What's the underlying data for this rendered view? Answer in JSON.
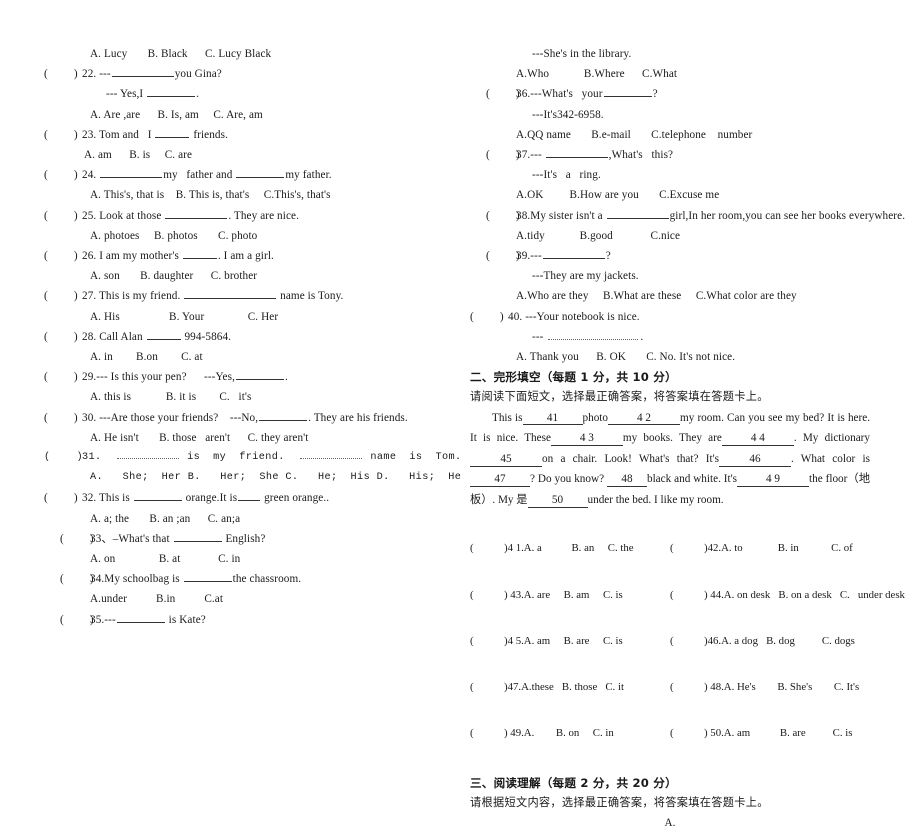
{
  "left_column": {
    "lines": [
      {
        "type": "opts",
        "text": "A. Lucy       B. Black      C. Lucy Black"
      },
      {
        "type": "q",
        "kind": "q22_stem"
      },
      {
        "type": "cont",
        "kind": "q22_answer"
      },
      {
        "type": "opts",
        "text": "A. Are ,are      B. Is, am     C. Are, am"
      },
      {
        "type": "q",
        "kind": "q23_stem"
      },
      {
        "type": "opts",
        "text": "A. am      B. is     C. are"
      },
      {
        "type": "q",
        "kind": "q24_stem"
      },
      {
        "type": "opts",
        "text": "A. This's, that is    B. This is, that's     C.This's, that's"
      },
      {
        "type": "q",
        "kind": "q25_stem"
      },
      {
        "type": "opts",
        "text": "A. photoes     B. photos       C. photo"
      },
      {
        "type": "q",
        "kind": "q26_stem"
      },
      {
        "type": "opts",
        "text": "A. son       B. daughter      C. brother"
      },
      {
        "type": "q",
        "kind": "q27_stem"
      },
      {
        "type": "opts",
        "text": "A. His                 B. Your               C. Her"
      },
      {
        "type": "q",
        "kind": "q28_stem"
      },
      {
        "type": "opts",
        "text": "A. in        B.on        C. at"
      },
      {
        "type": "q",
        "kind": "q29_stem"
      },
      {
        "type": "opts",
        "text": "A. this is            B. it is        C.   it's"
      },
      {
        "type": "q",
        "kind": "q30_stem"
      },
      {
        "type": "opts",
        "text": "A. He isn't       B. those   aren't      C. they aren't"
      },
      {
        "type": "q",
        "kind": "q31_stem"
      },
      {
        "type": "opts",
        "kind": "q31_opts"
      },
      {
        "type": "q",
        "kind": "q32_stem"
      },
      {
        "type": "opts",
        "text": "A. a; the       B. an ;an      C. an;a"
      },
      {
        "type": "q",
        "kind": "q33_stem"
      },
      {
        "type": "opts",
        "text": "A. on               B. at             C. in"
      },
      {
        "type": "q",
        "kind": "q34_stem"
      },
      {
        "type": "opts",
        "text": "A.under          B.in          C.at"
      },
      {
        "type": "q",
        "kind": "q35_stem"
      }
    ],
    "questions": {
      "q22": {
        "number": "22.",
        "pre": "---",
        "post": "you Gina?",
        "answer_pre": "--- Yes,I ",
        "answer_post": "."
      },
      "q23": {
        "number": "23.",
        "pre": "Tom and   I ",
        "post": " friends."
      },
      "q24": {
        "number": "24.",
        "pre": "",
        "mid": "my   father and ",
        "post": "my father."
      },
      "q25": {
        "number": "25.",
        "pre": "Look at those ",
        "post": ". They are nice."
      },
      "q26": {
        "number": "26.",
        "pre": "I am my mother's ",
        "post": ". I am a girl."
      },
      "q27": {
        "number": "27.",
        "pre": "This is my friend. ",
        "post": " name is Tony."
      },
      "q28": {
        "number": "28.",
        "pre": "Call Alan ",
        "post": " 994-5864."
      },
      "q29": {
        "number": "29.",
        "pre": "--- Is this your pen?      ---Yes,",
        "post": "."
      },
      "q30": {
        "number": "30.",
        "pre": "---Are those your friends?    ---No,",
        "post": ". They are his friends."
      },
      "q31": {
        "number": "31.",
        "mid": " is  my  friend. ",
        "post": " name  is  Tom.",
        "options": "A.   She;  Her B.   Her;  She C.   He;  His D.   His;  He"
      },
      "q32": {
        "number": "32.",
        "pre": "This is ",
        "mid": " orange.It is",
        "post": " green orange.."
      },
      "q33": {
        "number": "33、",
        "pre": "–What's that ",
        "post": " English?"
      },
      "q34": {
        "number": "34.",
        "pre": "My schoolbag is ",
        "post": "the chassroom."
      },
      "q35": {
        "number": "35.",
        "pre": "---",
        "post": " is Kate?"
      }
    }
  },
  "right_column": {
    "pre_lines": [
      {
        "type": "cont",
        "text": "---She's in the library."
      },
      {
        "type": "opts",
        "text": "A.Who            B.Where      C.What"
      }
    ],
    "questions": {
      "q36": {
        "number": "36.",
        "pre": "---What's   your",
        "post": "?",
        "answer": "---It's342-6958.",
        "options": "A.QQ name       B.e-mail       C.telephone    number"
      },
      "q37": {
        "number": "37.",
        "pre": "--- ",
        "post": ",What's   this?",
        "answer": "---It's   a   ring.",
        "options": "A.OK         B.How are you       C.Excuse me"
      },
      "q38": {
        "number": "38.",
        "pre": "My sister isn't a ",
        "post": "girl,In her room,you can see her books everywhere.",
        "options": "A.tidy            B.good             C.nice"
      },
      "q39": {
        "number": "39.",
        "pre": "---",
        "post": "?",
        "answer": "---They are my jackets.",
        "options": "A.Who are they     B.What are these     C.What color are they"
      },
      "q40": {
        "number": "40.",
        "pre": "---Your notebook is nice.",
        "answer_pre": "--- ",
        "answer_post": ".",
        "options": "A. Thank you      B. OK       C. No. It's not nice."
      }
    },
    "section2": {
      "heading": "二、完形填空（每题 1 分，共 10 分）",
      "instruction": "请阅读下面短文，选择最正确答案，将答案填在答题卡上。",
      "passage": {
        "seg1": "This is",
        "n41": "41",
        "seg2": "photo",
        "n42": "4 2",
        "seg3": "my room. Can you see my bed? It is here. It is nice. These",
        "n43": "4 3",
        "seg4": "my books. They are",
        "n44": "4 4",
        "seg5": ". My dictionary",
        "n45": "45",
        "seg6": "on a chair. Look! What's that? It's",
        "n46": "46",
        "seg7": ".    What color is",
        "n47": "47",
        "seg8": "? Do you know?",
        "n48": "48",
        "seg9": "black and white.   It's",
        "n49": "4 9",
        "seg10": "the floor（地板）. My 是",
        "n50": "50",
        "seg11": "under the bed. I like my room."
      },
      "answer_grid": [
        {
          "left_num": ")4 1.",
          "left": "A. a           B. an     C. the",
          "right_num": ")42.",
          "right": "A. to             B. in            C. of"
        },
        {
          "left_num": ") 43.",
          "left": "A. are     B. am     C. is",
          "right_num": ") 44.",
          "right": "A. on desk   B. on a desk   C.   under desk"
        },
        {
          "left_num": ")4 5.",
          "left": "A. am     B. are     C. is",
          "right_num": ")46.",
          "right": "A. a dog   B. dog          C. dogs"
        },
        {
          "left_num": ")47.",
          "left": "A.these   B. those   C. it",
          "right_num": ") 48.",
          "right": "A. He's        B. She's        C. It's"
        },
        {
          "left_num": ") 49.",
          "left": "A.        B. on     C. in",
          "right_num": ") 50.",
          "right": "A. am           B. are          C. is"
        }
      ]
    },
    "section3": {
      "heading": "三、阅读理解（每题 2 分，共 20 分）",
      "instruction": "请根据短文内容，选择最正确答案，将答案填在答题卡上。",
      "passage_label": "A."
    }
  }
}
